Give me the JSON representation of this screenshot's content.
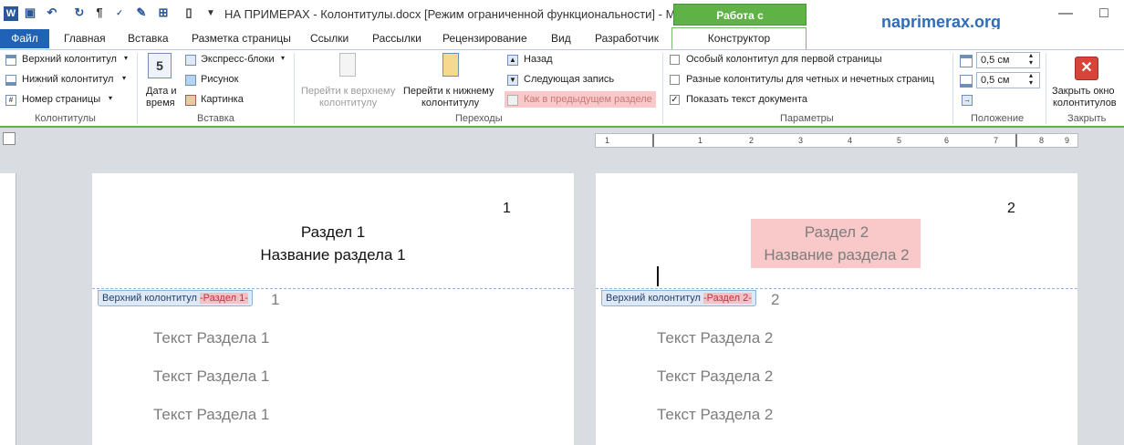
{
  "titlebar": {
    "title": "НА ПРИМЕРАХ - Колонтитулы.docx [Режим ограниченной функциональности]  -  Mi...",
    "context_tab": "Работа с колонтитулами",
    "brand": "naprimerax.org"
  },
  "tabs": {
    "file": "Файл",
    "items": [
      "Главная",
      "Вставка",
      "Разметка страницы",
      "Ссылки",
      "Рассылки",
      "Рецензирование",
      "Вид",
      "Разработчик"
    ],
    "active": "Конструктор"
  },
  "ribbon": {
    "headers_footers": {
      "header": "Верхний колонтитул",
      "footer": "Нижний колонтитул",
      "page_number": "Номер страницы",
      "group": "Колонтитулы"
    },
    "insert": {
      "date_time_1": "Дата и",
      "date_time_2": "время",
      "quick_parts": "Экспресс-блоки",
      "picture": "Рисунок",
      "clipart": "Картинка",
      "group": "Вставка"
    },
    "navigation": {
      "goto_header_1": "Перейти к верхнему",
      "goto_header_2": "колонтитулу",
      "goto_footer_1": "Перейти к нижнему",
      "goto_footer_2": "колонтитулу",
      "previous": "Назад",
      "next": "Следующая запись",
      "link_previous": "Как в предыдущем разделе",
      "group": "Переходы"
    },
    "options": {
      "first_page": "Особый колонтитул для первой страницы",
      "odd_even": "Разные колонтитулы для четных и нечетных страниц",
      "show_text": "Показать текст документа",
      "show_text_checked": true,
      "group": "Параметры"
    },
    "position": {
      "header_pos": "0,5 см",
      "footer_pos": "0,5 см",
      "group": "Положение"
    },
    "close": {
      "label_1": "Закрыть окно",
      "label_2": "колонтитулов",
      "group": "Закрыть"
    }
  },
  "ruler": {
    "marks": [
      "1",
      "1",
      "2",
      "3",
      "4",
      "5",
      "6",
      "7",
      "8",
      "9"
    ]
  },
  "pages": [
    {
      "number": "1",
      "header_line_1": "Раздел 1",
      "header_line_2": "Название раздела 1",
      "tag_label": "Верхний колонтитул",
      "tag_section": "-Раздел 1-",
      "body_hidden": "1",
      "body_lines": [
        "Текст Раздела 1",
        "Текст Раздела 1",
        "Текст Раздела 1"
      ]
    },
    {
      "number": "2",
      "header_line_1": "Раздел 2",
      "header_line_2": "Название раздела 2",
      "tag_label": "Верхний колонтитул",
      "tag_section": "-Раздел 2-",
      "body_hidden": "2",
      "body_lines": [
        "Текст Раздела 2",
        "Текст Раздела 2",
        "Текст Раздела 2"
      ]
    }
  ],
  "colors": {
    "accent_green": "#5fb246",
    "file_blue": "#1f62b6",
    "highlight_pink": "#f9c8c8"
  }
}
